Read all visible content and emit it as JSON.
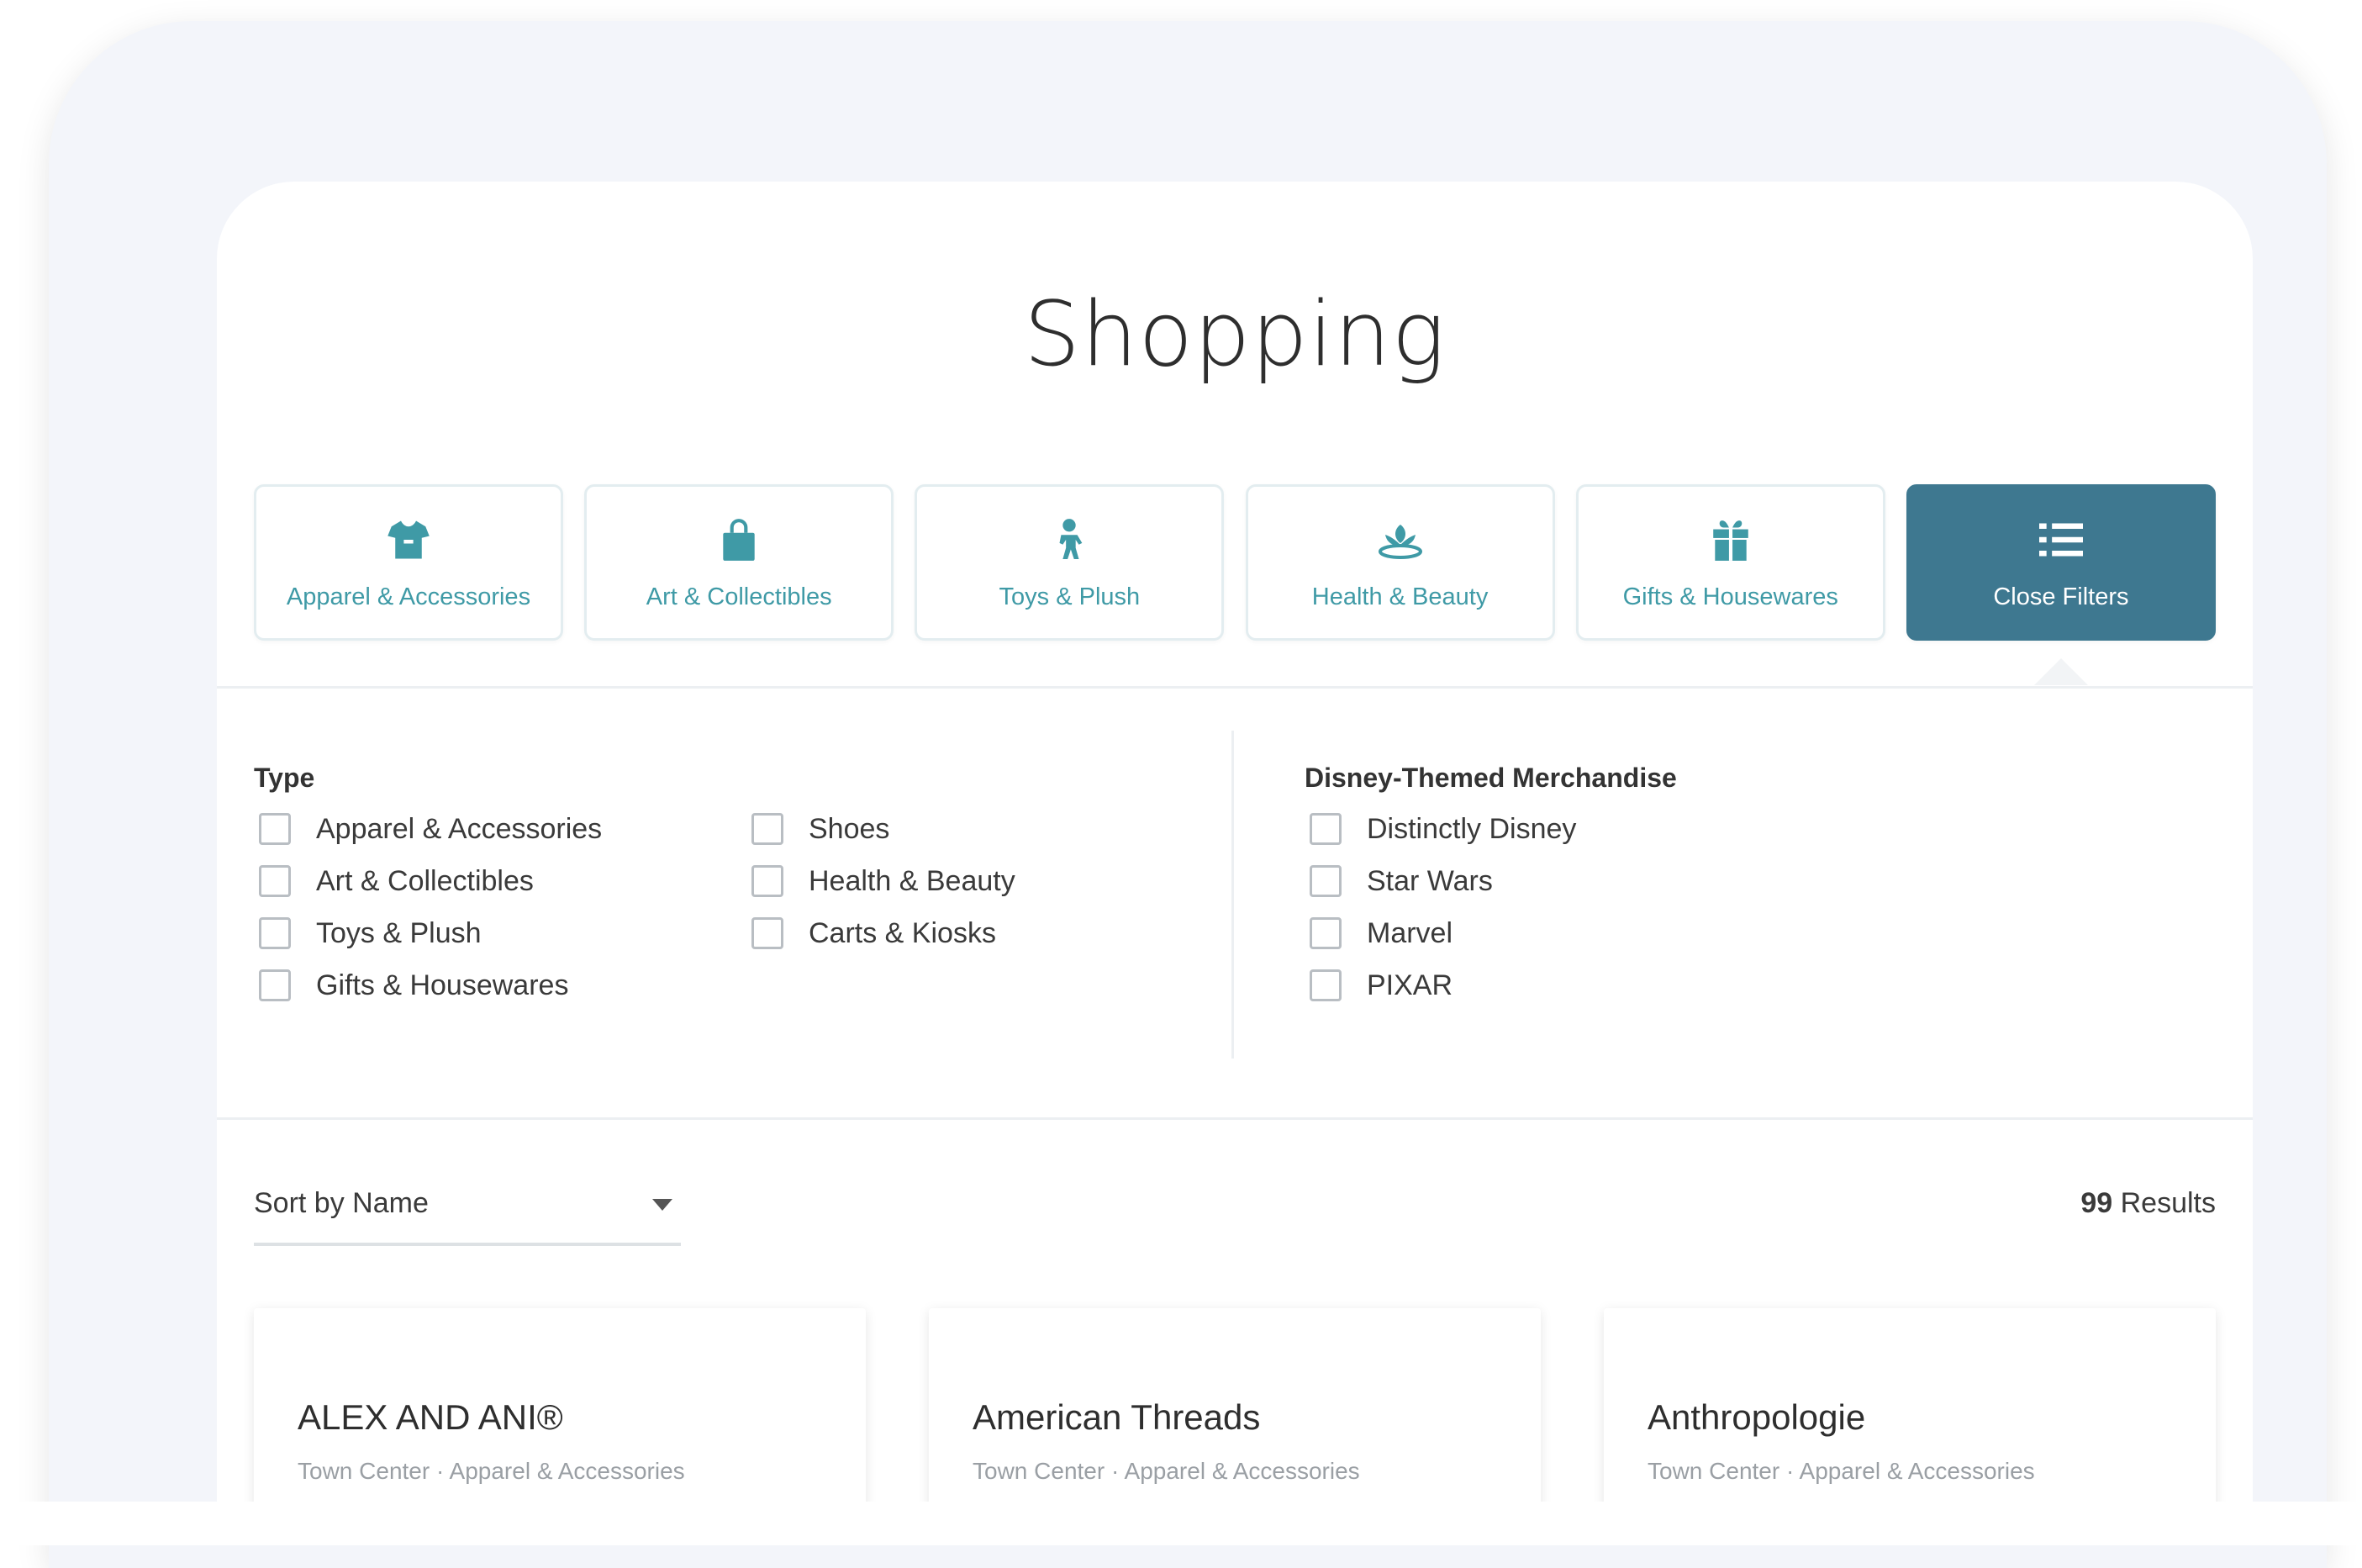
{
  "page": {
    "title": "Shopping"
  },
  "categories": [
    {
      "label": "Apparel & Accessories",
      "icon": "tshirt-icon"
    },
    {
      "label": "Art & Collectibles",
      "icon": "shopping-bag-icon"
    },
    {
      "label": "Toys & Plush",
      "icon": "toy-figure-icon"
    },
    {
      "label": "Health & Beauty",
      "icon": "spa-lotus-icon"
    },
    {
      "label": "Gifts & Housewares",
      "icon": "gift-icon"
    },
    {
      "label": "Close Filters",
      "icon": "list-icon",
      "active": true
    }
  ],
  "filters": {
    "type": {
      "title": "Type",
      "col1": [
        "Apparel & Accessories",
        "Art & Collectibles",
        "Toys & Plush",
        "Gifts & Housewares"
      ],
      "col2": [
        "Shoes",
        "Health & Beauty",
        "Carts & Kiosks"
      ]
    },
    "themed": {
      "title": "Disney-Themed Merchandise",
      "options": [
        "Distinctly Disney",
        "Star Wars",
        "Marvel",
        "PIXAR"
      ]
    }
  },
  "sort": {
    "label": "Sort by Name"
  },
  "results": {
    "count": "99",
    "label": "Results"
  },
  "stores": [
    {
      "name": "ALEX AND ANI®",
      "meta": "Town Center · Apparel & Accessories"
    },
    {
      "name": "American Threads",
      "meta": "Town Center · Apparel & Accessories"
    },
    {
      "name": "Anthropologie",
      "meta": "Town Center · Apparel & Accessories"
    }
  ],
  "colors": {
    "accent": "#3f9aa6",
    "active_tile": "#3e7890",
    "text": "#3a3a3a",
    "muted": "#9a9fa4"
  }
}
